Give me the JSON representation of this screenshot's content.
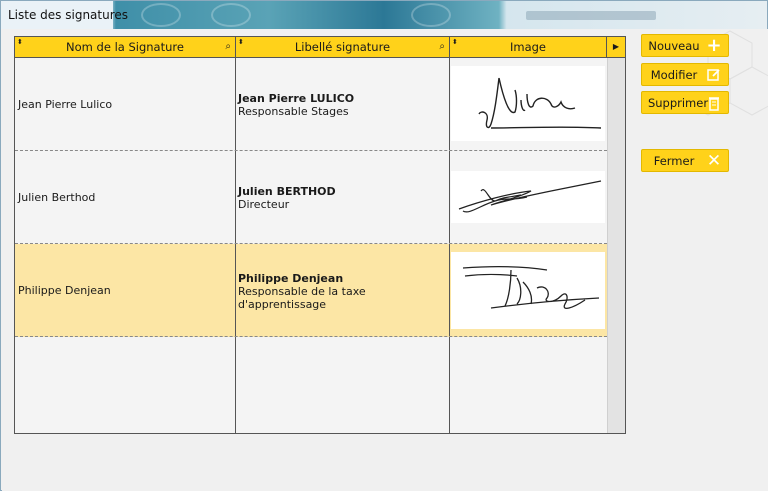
{
  "window": {
    "title": "Liste des signatures",
    "header_blurred_text": ""
  },
  "table": {
    "columns": [
      {
        "label": "Nom de la Signature",
        "searchable": true
      },
      {
        "label": "Libellé signature",
        "searchable": true
      },
      {
        "label": "Image",
        "searchable": false
      }
    ],
    "rows": [
      {
        "name": "Jean Pierre Lulico",
        "lib_title": "Jean Pierre LULICO",
        "lib_sub": "Responsable Stages",
        "selected": false
      },
      {
        "name": "Julien Berthod",
        "lib_title": "Julien BERTHOD",
        "lib_sub": "Directeur",
        "selected": false
      },
      {
        "name": "Philippe Denjean",
        "lib_title": "Philippe Denjean",
        "lib_sub": "Responsable de la taxe d'apprentissage",
        "selected": true
      },
      {
        "name": "",
        "lib_title": "",
        "lib_sub": "",
        "selected": false
      }
    ]
  },
  "buttons": {
    "new": "Nouveau",
    "modify": "Modifier",
    "delete": "Supprimer",
    "close": "Fermer"
  },
  "colors": {
    "accent": "#ffd21a",
    "selected_row": "#fce6a5"
  },
  "icons": {
    "new": "plus-icon",
    "modify": "edit-icon",
    "delete": "trash-icon",
    "close": "close-icon"
  }
}
